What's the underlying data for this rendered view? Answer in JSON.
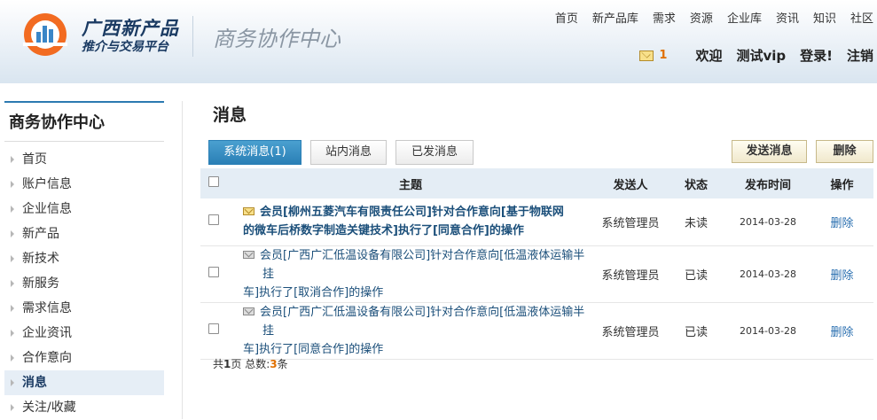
{
  "brand": {
    "title": "广西新产品",
    "subtitle": "推介与交易平台",
    "section_title": "商务协作中心"
  },
  "topnav": [
    "首页",
    "新产品库",
    "需求",
    "资源",
    "企业库",
    "资讯",
    "知识",
    "社区"
  ],
  "userbar": {
    "message_count": "1",
    "welcome": "欢迎",
    "username": "测试vip",
    "login": "登录!",
    "logout": "注销"
  },
  "sidebar": {
    "title": "商务协作中心",
    "items": [
      "首页",
      "账户信息",
      "企业信息",
      "新产品",
      "新技术",
      "新服务",
      "需求信息",
      "企业资讯",
      "合作意向",
      "消息",
      "关注/收藏"
    ],
    "active": "消息"
  },
  "page": {
    "title": "消息"
  },
  "tabs": [
    "系统消息(1)",
    "站内消息",
    "已发消息"
  ],
  "buttons": {
    "send": "发送消息",
    "delete": "删除"
  },
  "table": {
    "headers": {
      "subject": "主题",
      "sender": "发送人",
      "status": "状态",
      "time": "发布时间",
      "action": "操作"
    },
    "rows": [
      {
        "subject_line1": "会员[柳州五菱汽车有限责任公司]针对合作意向[基于物联网",
        "subject_line2": "的微车后桥数字制造关键技术]执行了[同意合作]的操作",
        "sender": "系统管理员",
        "status": "未读",
        "time": "2014-03-28",
        "action": "删除"
      },
      {
        "subject_line1": "会员[广西广汇低温设备有限公司]针对合作意向[低温液体运输半挂",
        "subject_line2": "车]执行了[取消合作]的操作",
        "sender": "系统管理员",
        "status": "已读",
        "time": "2014-03-28",
        "action": "删除"
      },
      {
        "subject_line1": "会员[广西广汇低温设备有限公司]针对合作意向[低温液体运输半挂",
        "subject_line2": "车]执行了[同意合作]的操作",
        "sender": "系统管理员",
        "status": "已读",
        "time": "2014-03-28",
        "action": "删除"
      }
    ]
  },
  "footer": {
    "prefix": "共",
    "pages": "1",
    "mid": "页 总数:",
    "total": "3",
    "suffix": "条"
  },
  "icons": {
    "logo": "logo-icon",
    "mail": "mail-icon",
    "unread": "mail-open-icon",
    "read": "mail-closed-icon"
  },
  "colors": {
    "accent": "#2a7fb6",
    "brand_text": "#1b3b63",
    "count": "#e07000",
    "link": "#2a6fb0"
  }
}
